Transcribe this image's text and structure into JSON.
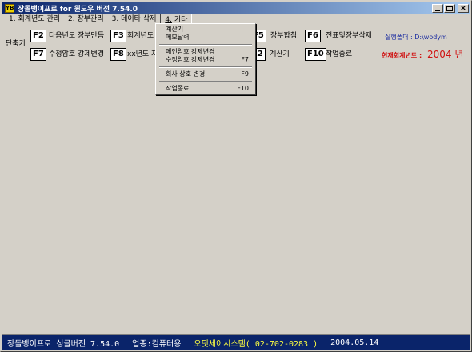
{
  "window": {
    "title": "장돌뱅이프로 for 윈도우 버전 7.54.0",
    "icon": "app-logo-icon",
    "icon_text": "YB"
  },
  "menubar": {
    "items": [
      {
        "key": "1.",
        "label": "회계년도 관리"
      },
      {
        "key": "2.",
        "label": "장부관리"
      },
      {
        "key": "3.",
        "label": "데이타 삭제"
      },
      {
        "key": "4.",
        "label": "기타"
      }
    ]
  },
  "toolbar": {
    "label": "단축키",
    "row1": [
      {
        "key": "F2",
        "label": "다음년도 장부만듬"
      },
      {
        "key": "F3",
        "label": "회계년도"
      },
      {
        "key": "F5",
        "label": "장부합침"
      },
      {
        "key": "F6",
        "label": "전표및장부삭제"
      }
    ],
    "row2": [
      {
        "key": "F7",
        "label": "수정암호 강제변경"
      },
      {
        "key": "F8",
        "label": "xx년도 자"
      },
      {
        "key": "F12",
        "label": "계산기"
      },
      {
        "key": "F10",
        "label": "작업종료"
      }
    ],
    "run_folder": "실행폴더 : D:\\wodym",
    "year_label": "현재회계년도 :",
    "year_value": "2004 년"
  },
  "dropdown": {
    "group1": [
      {
        "label": "계산기",
        "shortcut": ""
      },
      {
        "label": "메모달력",
        "shortcut": ""
      }
    ],
    "group2": [
      {
        "label": "메인암호 강제변경",
        "shortcut": ""
      },
      {
        "label": "수정암호 강제변경",
        "shortcut": "F7"
      }
    ],
    "group3": [
      {
        "label": "회사 상호 변경",
        "shortcut": "F9"
      }
    ],
    "group4": [
      {
        "label": "작업종료",
        "shortcut": "F10"
      }
    ]
  },
  "statusbar": {
    "product": "장돌뱅이프로 싱글버전 7.54.0",
    "business": "업종:컴퓨터용",
    "company": "오딧세이시스템( 02-702-0283 )",
    "date": "2004.05.14"
  },
  "colors": {
    "title_start": "#0a246a",
    "title_end": "#a6caf0",
    "statusbar_bg": "#0a246a",
    "year_red": "#d01010",
    "folder_blue": "#1a2ba0"
  }
}
